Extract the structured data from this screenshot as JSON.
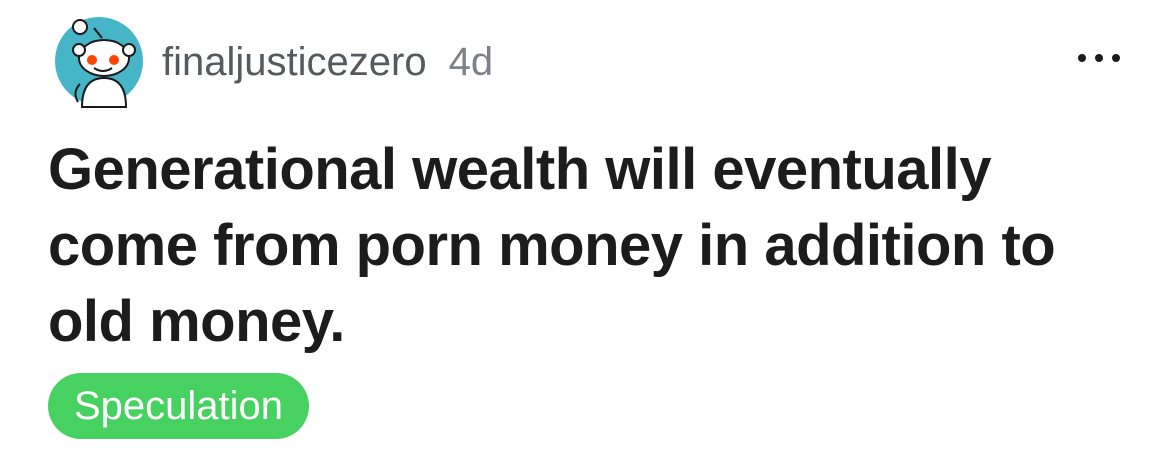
{
  "post": {
    "author": "finaljusticezero",
    "age": "4d",
    "title": "Generational wealth will eventually come from porn money in addition to old money.",
    "flair": "Speculation"
  },
  "icons": {
    "avatar": "snoo-avatar-icon",
    "more": "more-options-icon"
  },
  "colors": {
    "avatar_background": "#46b5c8",
    "flair_background": "#46d160",
    "flair_text": "#ffffff",
    "title_text": "#1c1c1c",
    "meta_text": "#555a5e",
    "snoo_eye": "#ff4500"
  }
}
